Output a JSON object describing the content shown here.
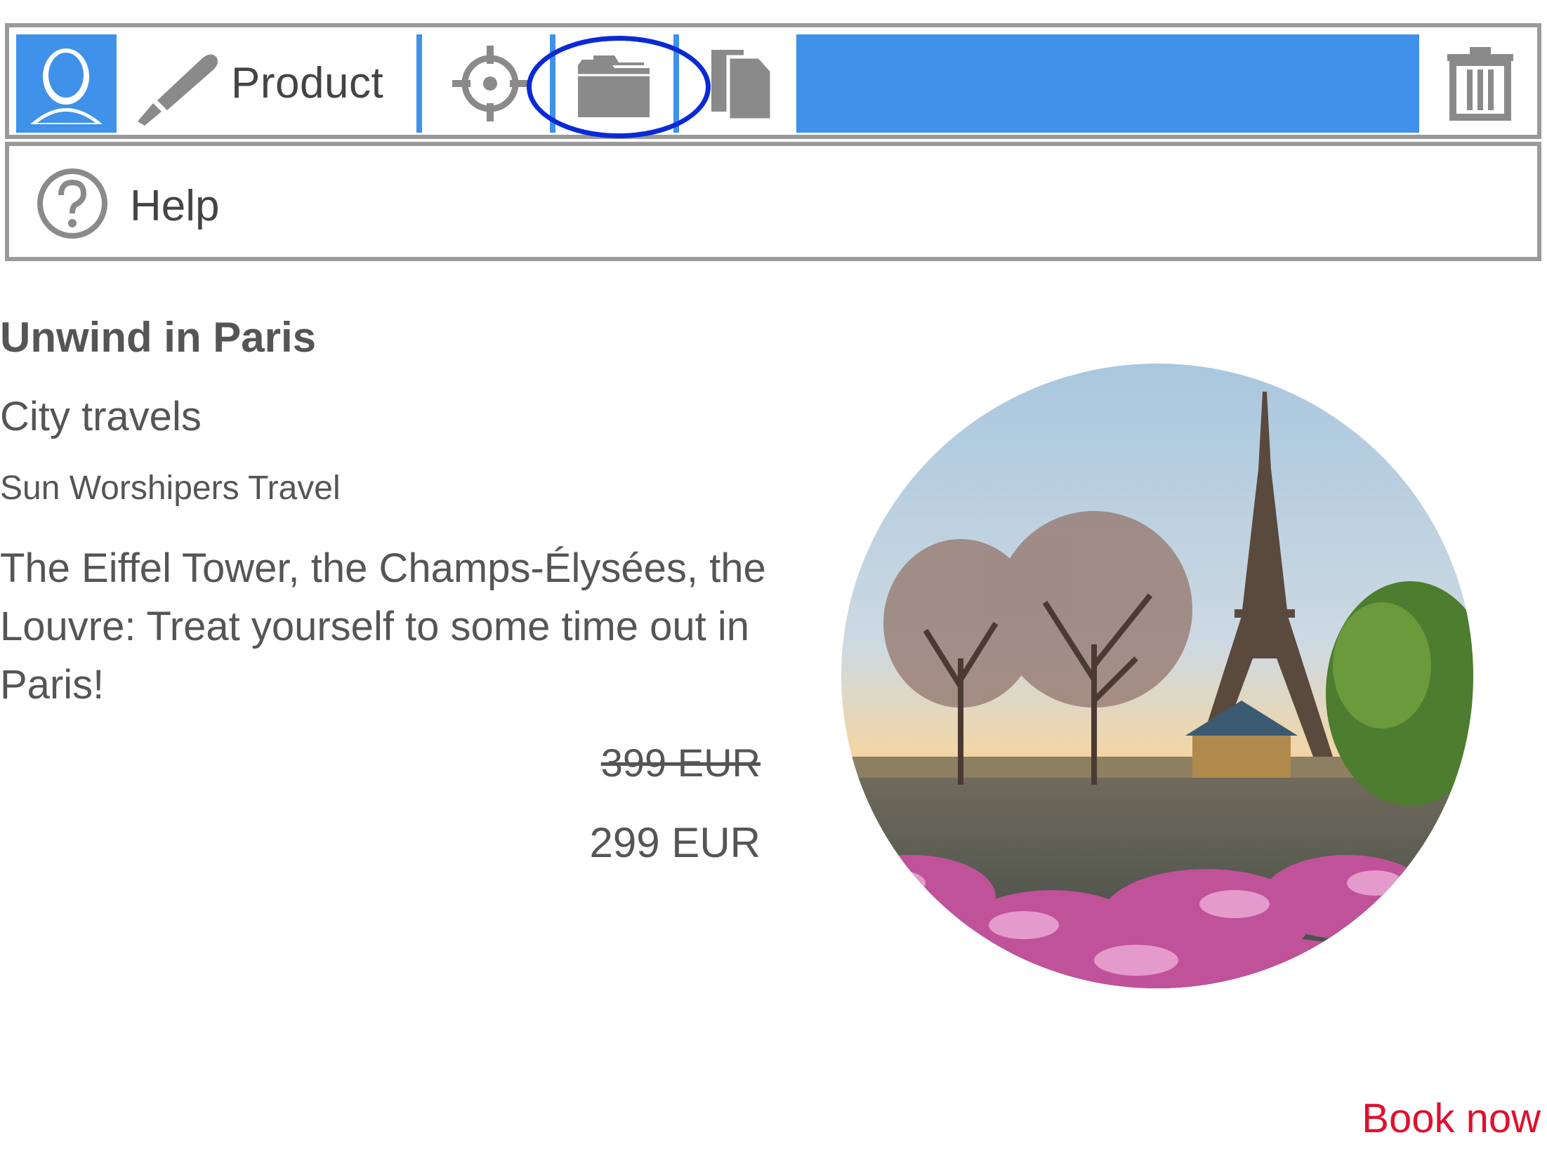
{
  "toolbar": {
    "product_label": "Product",
    "accent_color": "#3f91ea",
    "icons": [
      "user-icon",
      "brush-icon",
      "target-icon",
      "folder-icon",
      "copy-icon",
      "trash-icon"
    ],
    "highlight_color": "#0a2ad6"
  },
  "help": {
    "label": "Help",
    "icon": "question-circle-icon"
  },
  "content": {
    "title": "Unwind in Paris",
    "category": "City travels",
    "company": "Sun Worshipers Travel",
    "description": "The Eiffel Tower, the Champs-Élysées, the Louvre: Treat yourself to some time out in Paris!",
    "old_price": "399 EUR",
    "new_price": "299 EUR",
    "image": "paris-eiffel-tower-photo",
    "cta": "Book now",
    "cta_color": "#e0102f"
  }
}
